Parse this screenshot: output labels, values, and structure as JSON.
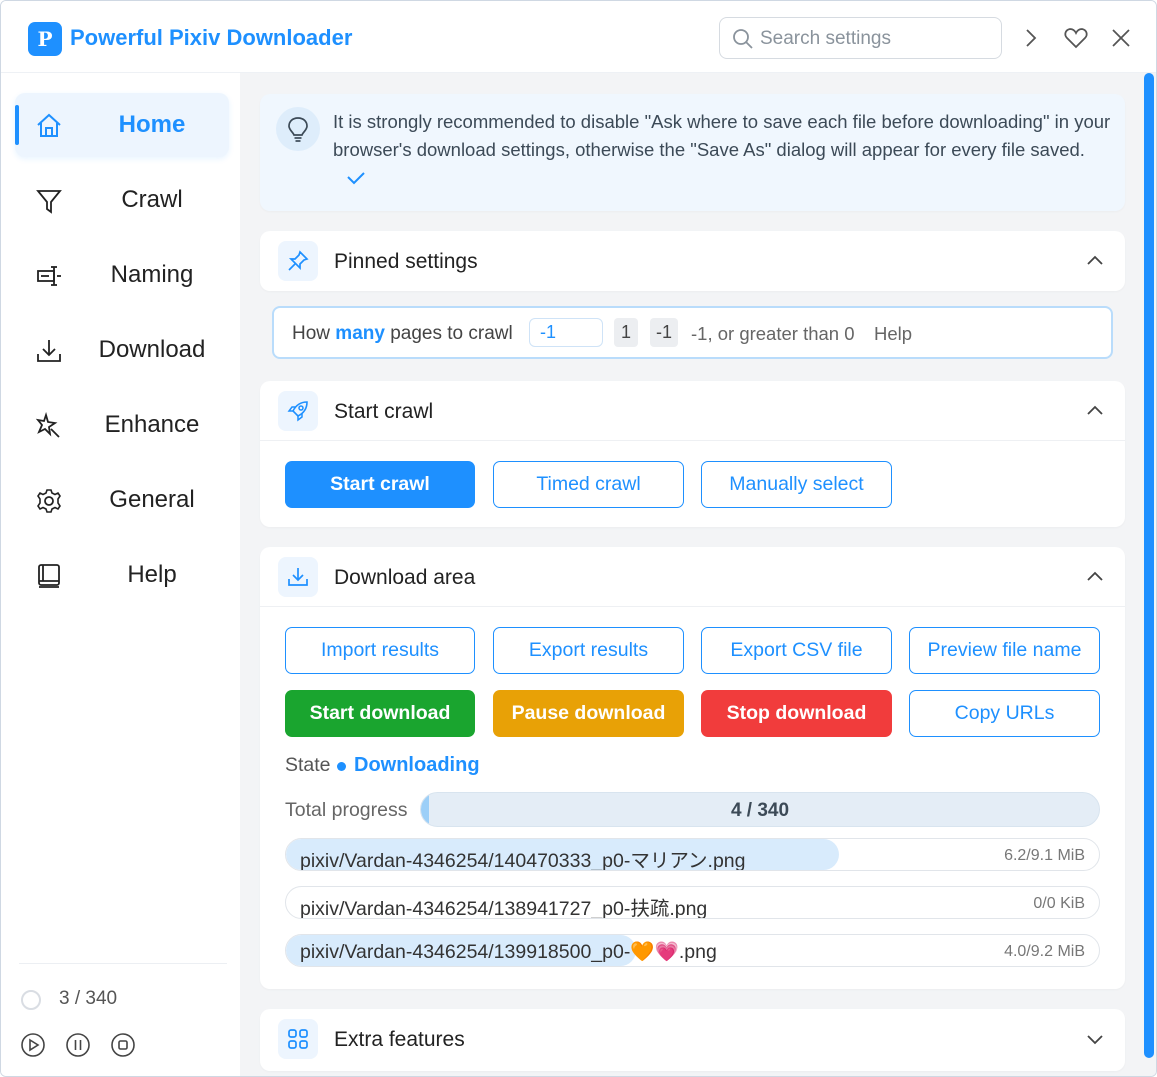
{
  "app": {
    "title": "Powerful Pixiv Downloader",
    "logo_text": "P"
  },
  "search": {
    "placeholder": "Search settings"
  },
  "sidebar": {
    "items": [
      {
        "label": "Home",
        "icon": "home-icon",
        "active": true
      },
      {
        "label": "Crawl",
        "icon": "filter-icon",
        "active": false
      },
      {
        "label": "Naming",
        "icon": "naming-icon",
        "active": false
      },
      {
        "label": "Download",
        "icon": "download-icon",
        "active": false
      },
      {
        "label": "Enhance",
        "icon": "sparkle-icon",
        "active": false
      },
      {
        "label": "General",
        "icon": "gear-icon",
        "active": false
      },
      {
        "label": "Help",
        "icon": "book-icon",
        "active": false
      }
    ],
    "status_count": "3 / 340"
  },
  "tip": {
    "text": "It is strongly recommended to disable \"Ask where to save each file before downloading\" in your browser's download settings, otherwise the \"Save As\" dialog will appear for every file saved."
  },
  "pinned": {
    "title": "Pinned settings",
    "label_prefix": "How ",
    "label_bold": "many",
    "label_suffix": " pages to crawl",
    "input_value": "-1",
    "chip_1": "1",
    "chip_2": "-1",
    "hint": "-1, or greater than 0",
    "help": "Help"
  },
  "crawl": {
    "title": "Start crawl",
    "start_label": "Start crawl",
    "timed_label": "Timed crawl",
    "manual_label": "Manually select"
  },
  "download": {
    "title": "Download area",
    "import_label": "Import results",
    "export_label": "Export results",
    "csv_label": "Export CSV file",
    "preview_label": "Preview file name",
    "start_label": "Start download",
    "pause_label": "Pause download",
    "stop_label": "Stop download",
    "copy_label": "Copy URLs",
    "state_label": "State",
    "state_value": "Downloading",
    "total_label": "Total progress",
    "total_text": "4 / 340",
    "total_fraction": 0.0118,
    "files": [
      {
        "name": "pixiv/Vardan-4346254/140470333_p0-マリアン.png",
        "size": "6.2/9.1 MiB",
        "progress": 0.68
      },
      {
        "name": "pixiv/Vardan-4346254/138941727_p0-扶疏.png",
        "size": "0/0 KiB",
        "progress": 0
      },
      {
        "name": "pixiv/Vardan-4346254/139918500_p0-🧡💗.png",
        "size": "4.0/9.2 MiB",
        "progress": 0.43
      }
    ]
  },
  "extra": {
    "title": "Extra features"
  },
  "colors": {
    "accent": "#1e90ff",
    "green": "#1aa52f",
    "orange": "#e8a106",
    "red": "#f13c3c"
  }
}
